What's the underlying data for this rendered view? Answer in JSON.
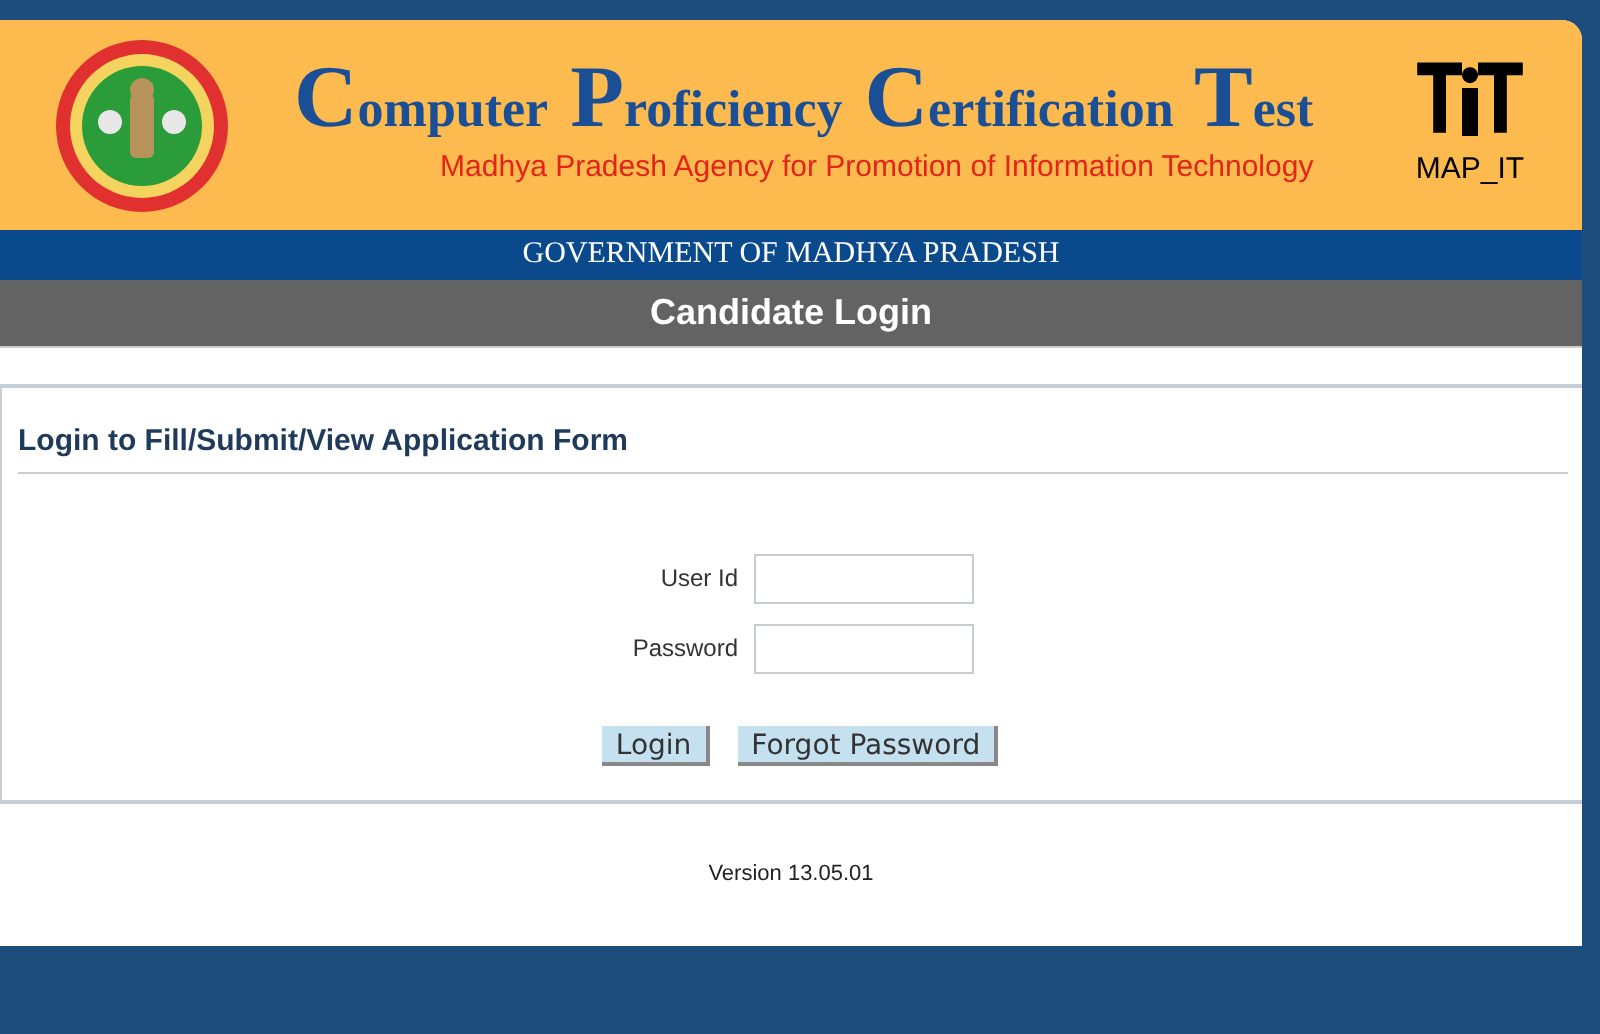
{
  "header": {
    "title": "Computer Proficiency Certification Test",
    "subtitle": "Madhya Pradesh Agency for Promotion of Information Technology",
    "logo_text": "MAP_IT"
  },
  "government_bar": "GOVERNMENT OF MADHYA PRADESH",
  "page_title": "Candidate Login",
  "section_heading": "Login to Fill/Submit/View Application Form",
  "fields": [
    {
      "label": "User Id"
    },
    {
      "label": "Password"
    }
  ],
  "buttons": [
    "Login",
    "Forgot Password"
  ],
  "version": "Version 13.05.01"
}
